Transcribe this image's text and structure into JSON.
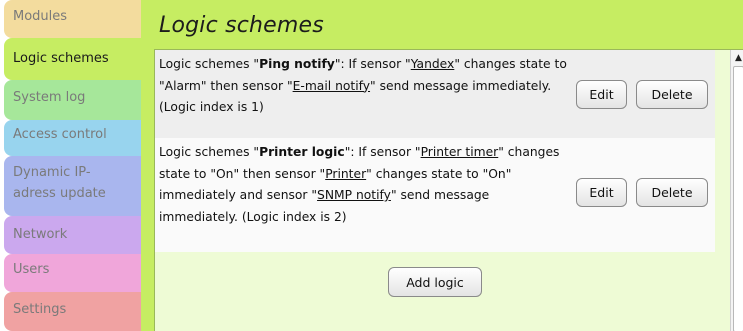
{
  "sidebar": {
    "items": [
      {
        "label": "Modules",
        "color": "#f3dc9e"
      },
      {
        "label": "Logic schemes",
        "color": "#c6ed62",
        "active": true
      },
      {
        "label": "System log",
        "color": "#a6e79a"
      },
      {
        "label": "Access control",
        "color": "#98d4ee"
      },
      {
        "label_line1": "Dynamic IP-",
        "label_line2": "adress update",
        "color": "#a9b6ee"
      },
      {
        "label": "Network",
        "color": "#cba8ee"
      },
      {
        "label": "Users",
        "color": "#f0a6da"
      },
      {
        "label": "Settings",
        "color": "#f0a2a2"
      }
    ]
  },
  "main": {
    "title": "Logic schemes",
    "rows": [
      {
        "p1": "Logic schemes \"",
        "name": "Ping notify",
        "p2": "\": If sensor \"",
        "s1": "Yandex",
        "p3": "\" changes state to \"Alarm\" then sensor \"",
        "s2": "E-mail notify",
        "p4": "\" send message immediately. (Logic index is 1)",
        "edit": "Edit",
        "delete": "Delete"
      },
      {
        "p1": "Logic schemes \"",
        "name": "Printer logic",
        "p2": "\": If sensor \"",
        "s1": "Printer timer",
        "p3": "\" changes state to \"On\" then sensor \"",
        "s2": "Printer",
        "p4": "\" changes state to \"On\" immediately and sensor \"",
        "s3": "SNMP notify",
        "p5": "\" send message immediately. (Logic index is 2)",
        "edit": "Edit",
        "delete": "Delete"
      }
    ],
    "add_label": "Add logic"
  },
  "scrollbar": {
    "up_icon": "triangle-up"
  },
  "colors": {
    "main_bg": "#c6ed62",
    "panel_bg": "#eefbd5"
  }
}
